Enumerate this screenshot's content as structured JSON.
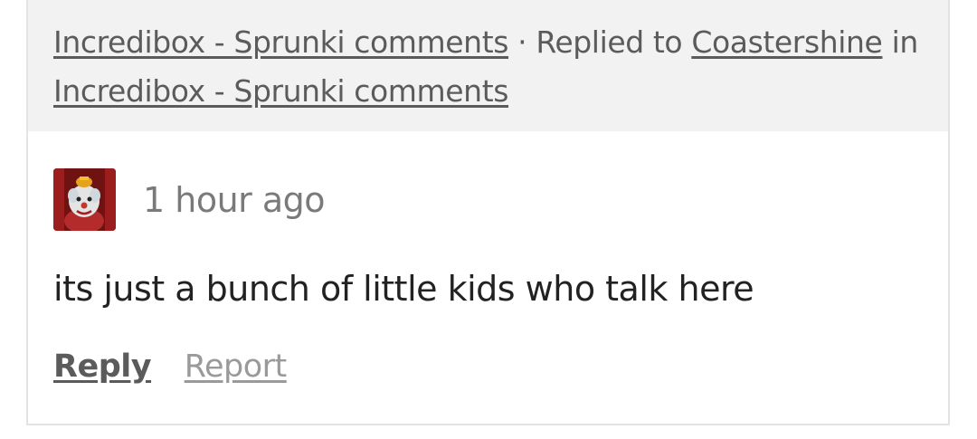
{
  "context": {
    "page_link": "Incredibox - Sprunki comments",
    "separator": "·",
    "replied_prefix": "Replied to",
    "reply_target": "Coastershine",
    "in_text": "in",
    "thread_link": "Incredibox - Sprunki comments"
  },
  "comment": {
    "avatar_icon": "clown-avatar-icon",
    "timestamp": "1 hour ago",
    "body": "its just a bunch of little kids who talk here"
  },
  "actions": {
    "reply_label": "Reply",
    "report_label": "Report"
  }
}
